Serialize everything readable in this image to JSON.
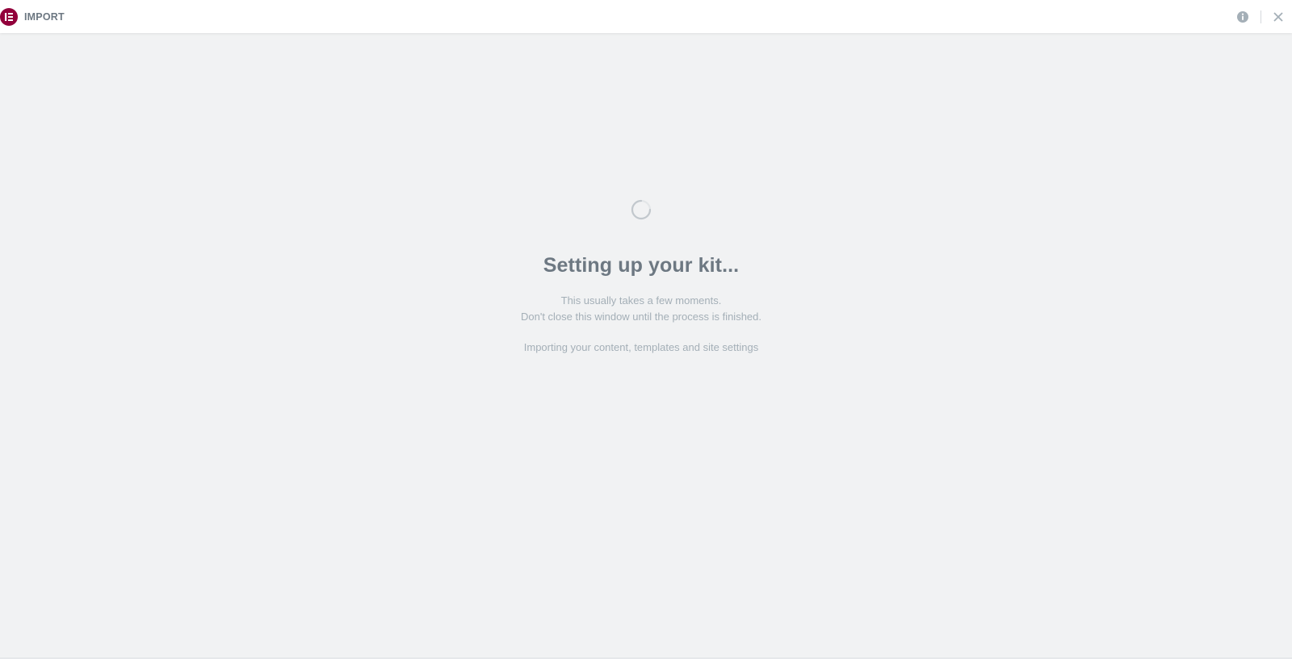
{
  "header": {
    "title": "IMPORT",
    "logo_icon": "elementor-logo-icon",
    "info_icon": "info-icon",
    "close_icon": "close-icon"
  },
  "main": {
    "heading": "Setting up your kit...",
    "description_line1": "This usually takes a few moments.",
    "description_line2": "Don't close this window until the process is finished.",
    "status": "Importing your content, templates and site settings"
  },
  "colors": {
    "brand": "#92003b",
    "header_bg": "#ffffff",
    "page_bg": "#f1f2f3",
    "heading_text": "#6d7882",
    "muted_text": "#a4afb7"
  }
}
